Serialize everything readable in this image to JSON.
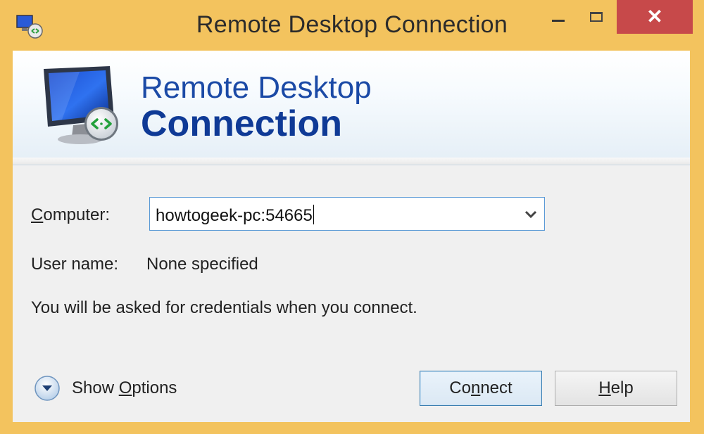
{
  "window": {
    "title": "Remote Desktop Connection"
  },
  "banner": {
    "line1": "Remote Desktop",
    "line2": "Connection"
  },
  "computer": {
    "label_prefix": "C",
    "label_rest": "omputer:",
    "value": "howtogeek-pc:54665"
  },
  "user": {
    "label": "User name:",
    "value": "None specified"
  },
  "info": "You will be asked for credentials when you connect.",
  "options": {
    "label_prefix": "Show ",
    "label_accel": "O",
    "label_rest": "ptions"
  },
  "buttons": {
    "connect_pre": "Co",
    "connect_accel": "n",
    "connect_rest": "nect",
    "help_accel": "H",
    "help_rest": "elp"
  },
  "icons": {
    "app": "remote-desktop-icon",
    "banner": "monitor-connection-icon",
    "dropdown": "chevron-down-icon",
    "options": "expand-circle-icon"
  },
  "colors": {
    "frame": "#f3c35e",
    "close": "#c7494a",
    "banner_text": "#1b4aa6",
    "focus": "#5a9ad6"
  }
}
